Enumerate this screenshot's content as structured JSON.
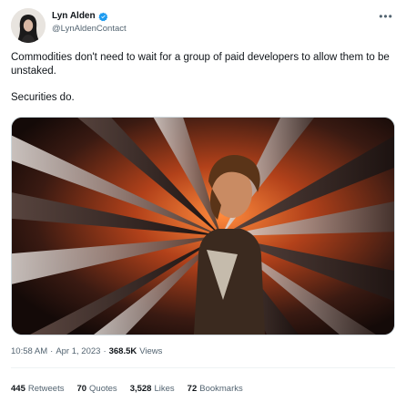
{
  "author": {
    "display_name": "Lyn Alden",
    "handle": "@LynAldenContact",
    "verified": true,
    "avatar_icon": "profile-photo"
  },
  "more_icon": "ellipsis-icon",
  "tweet": {
    "text_line1": "Commodities don't need to wait for a group of paid developers to allow them to be unstaked.",
    "text_line2": "Securities do."
  },
  "media": {
    "description_icon": "animated-still-image"
  },
  "meta": {
    "time": "10:58 AM",
    "separator": "·",
    "date": "Apr 1, 2023",
    "views_count": "368.5K",
    "views_label": "Views"
  },
  "stats": {
    "retweets_count": "445",
    "retweets_label": "Retweets",
    "quotes_count": "70",
    "quotes_label": "Quotes",
    "likes_count": "3,528",
    "likes_label": "Likes",
    "bookmarks_count": "72",
    "bookmarks_label": "Bookmarks"
  },
  "colors": {
    "text_primary": "#0f1419",
    "text_secondary": "#536471",
    "verified_blue": "#1d9bf0",
    "divider": "#eff3f4"
  }
}
